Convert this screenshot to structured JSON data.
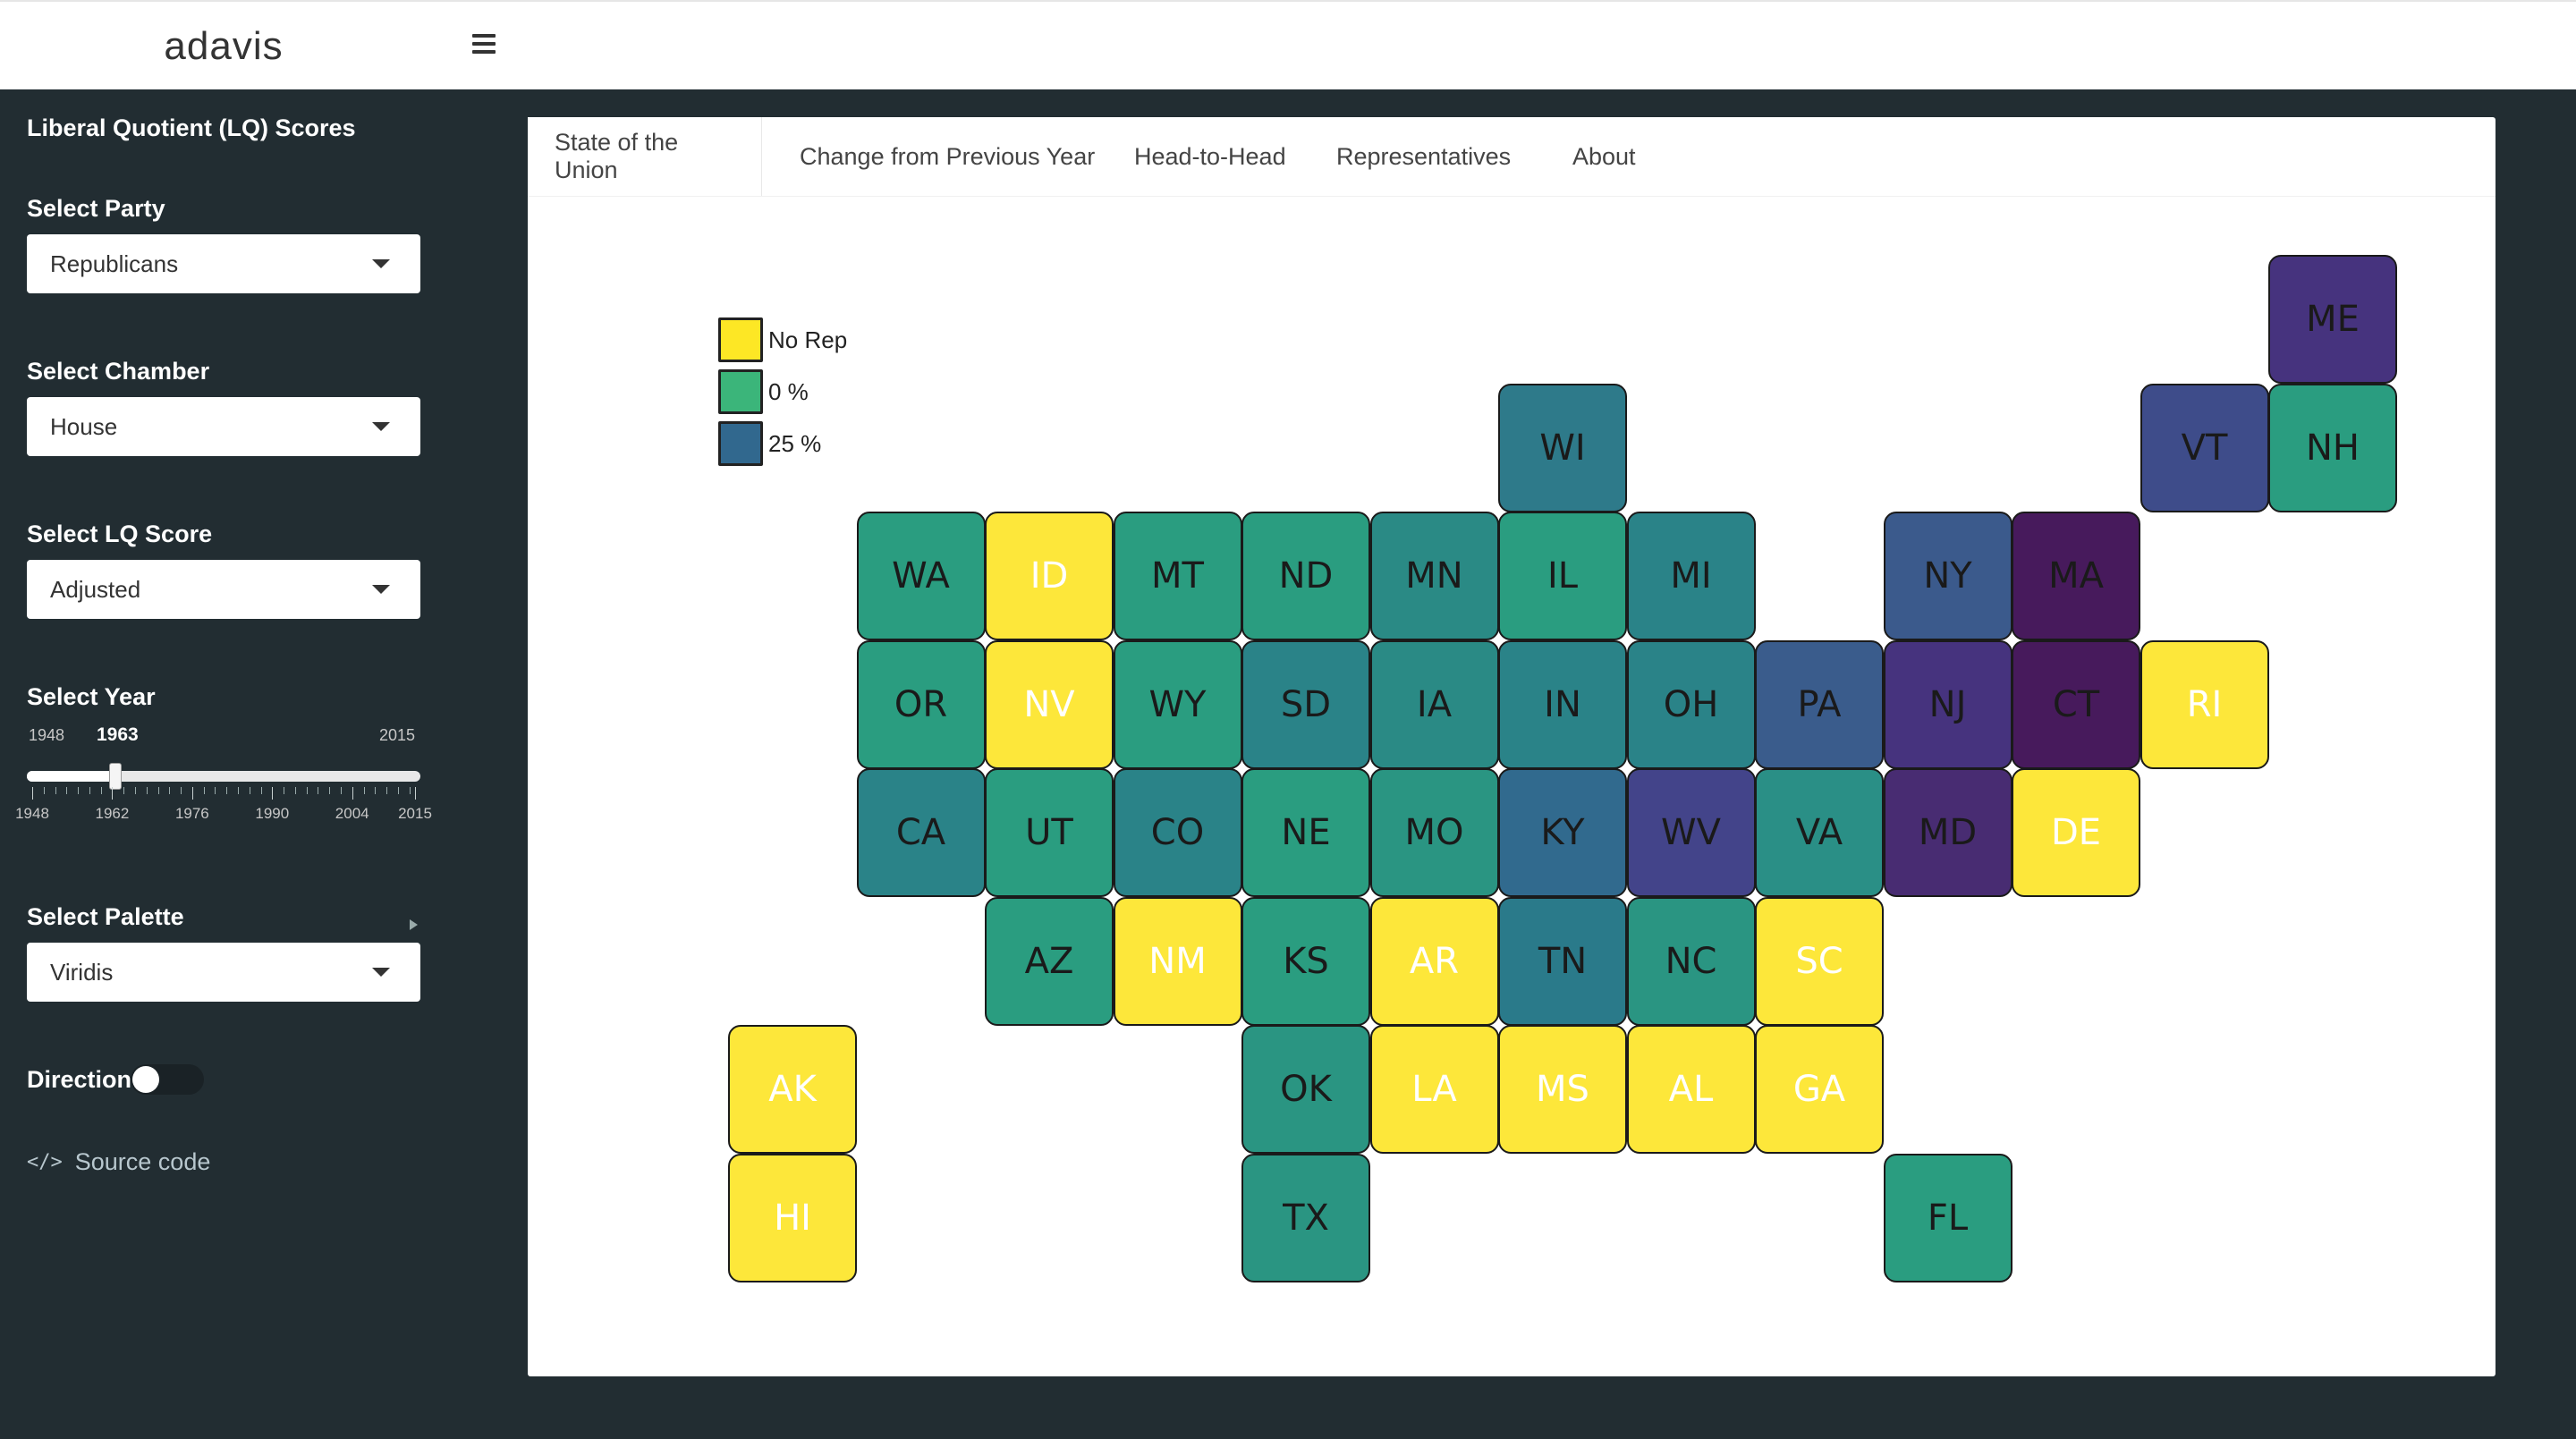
{
  "header": {
    "logo": "adavis"
  },
  "sidebar": {
    "title": "Liberal Quotient (LQ) Scores",
    "party": {
      "label": "Select Party",
      "value": "Republicans"
    },
    "chamber": {
      "label": "Select Chamber",
      "value": "House"
    },
    "score": {
      "label": "Select LQ Score",
      "value": "Adjusted"
    },
    "year": {
      "label": "Select Year",
      "min": "1948",
      "max": "2015",
      "value": "1963",
      "value_fraction": 0.224,
      "tick_labels": [
        "1948",
        "1962",
        "1976",
        "1990",
        "2004",
        "2015"
      ]
    },
    "palette": {
      "label": "Select Palette",
      "value": "Viridis"
    },
    "direction": {
      "label": "Direction",
      "on": false
    },
    "source": {
      "label": "Source code",
      "icon": "code-icon"
    }
  },
  "tabs": [
    {
      "label": "State of the Union",
      "active": true
    },
    {
      "label": "Change from Previous Year",
      "active": false
    },
    {
      "label": "Head-to-Head",
      "active": false
    },
    {
      "label": "Representatives",
      "active": false
    },
    {
      "label": "About",
      "active": false
    }
  ],
  "legend": [
    {
      "label": "No Rep",
      "color": "#fde725"
    },
    {
      "label": "0 %",
      "color": "#3bb57a"
    },
    {
      "label": "25 %",
      "color": "#31688e"
    }
  ],
  "states": [
    {
      "abbr": "ME",
      "color": "#46337e",
      "text": "#1a1a1a"
    },
    {
      "abbr": "WI",
      "color": "#2e7a8a",
      "text": "#1a1a1a"
    },
    {
      "abbr": "VT",
      "color": "#3e4c8a",
      "text": "#1a1a1a"
    },
    {
      "abbr": "NH",
      "color": "#2a9d80",
      "text": "#1a1a1a"
    },
    {
      "abbr": "WA",
      "color": "#2a9d80",
      "text": "#1a1a1a"
    },
    {
      "abbr": "ID",
      "color": "#fde73a",
      "text": "#ffffff"
    },
    {
      "abbr": "MT",
      "color": "#2a9d80",
      "text": "#1a1a1a"
    },
    {
      "abbr": "ND",
      "color": "#2a9d80",
      "text": "#1a1a1a"
    },
    {
      "abbr": "MN",
      "color": "#2a8a85",
      "text": "#1a1a1a"
    },
    {
      "abbr": "IL",
      "color": "#2a9d80",
      "text": "#1a1a1a"
    },
    {
      "abbr": "MI",
      "color": "#2a8388",
      "text": "#1a1a1a"
    },
    {
      "abbr": "NY",
      "color": "#3b5a8c",
      "text": "#1a1a1a"
    },
    {
      "abbr": "MA",
      "color": "#471a5c",
      "text": "#1a1a1a"
    },
    {
      "abbr": "OR",
      "color": "#2a9d80",
      "text": "#1a1a1a"
    },
    {
      "abbr": "NV",
      "color": "#fde73a",
      "text": "#ffffff"
    },
    {
      "abbr": "WY",
      "color": "#2a9d80",
      "text": "#1a1a1a"
    },
    {
      "abbr": "SD",
      "color": "#2a8388",
      "text": "#1a1a1a"
    },
    {
      "abbr": "IA",
      "color": "#2a8a85",
      "text": "#1a1a1a"
    },
    {
      "abbr": "IN",
      "color": "#2a8388",
      "text": "#1a1a1a"
    },
    {
      "abbr": "OH",
      "color": "#2a8388",
      "text": "#1a1a1a"
    },
    {
      "abbr": "PA",
      "color": "#3a5c8c",
      "text": "#1a1a1a"
    },
    {
      "abbr": "NJ",
      "color": "#46337e",
      "text": "#1a1a1a"
    },
    {
      "abbr": "CT",
      "color": "#471a5c",
      "text": "#1a1a1a"
    },
    {
      "abbr": "RI",
      "color": "#fde73a",
      "text": "#ffffff"
    },
    {
      "abbr": "CA",
      "color": "#2a8388",
      "text": "#1a1a1a"
    },
    {
      "abbr": "UT",
      "color": "#2a9d80",
      "text": "#1a1a1a"
    },
    {
      "abbr": "CO",
      "color": "#2a8388",
      "text": "#1a1a1a"
    },
    {
      "abbr": "NE",
      "color": "#2a9d80",
      "text": "#1a1a1a"
    },
    {
      "abbr": "MO",
      "color": "#2a9582",
      "text": "#1a1a1a"
    },
    {
      "abbr": "KY",
      "color": "#316a8e",
      "text": "#1a1a1a"
    },
    {
      "abbr": "WV",
      "color": "#43448a",
      "text": "#1a1a1a"
    },
    {
      "abbr": "VA",
      "color": "#2a8f86",
      "text": "#1a1a1a"
    },
    {
      "abbr": "MD",
      "color": "#482c72",
      "text": "#1a1a1a"
    },
    {
      "abbr": "DE",
      "color": "#fde73a",
      "text": "#ffffff"
    },
    {
      "abbr": "AZ",
      "color": "#2a9d80",
      "text": "#1a1a1a"
    },
    {
      "abbr": "NM",
      "color": "#fde73a",
      "text": "#ffffff"
    },
    {
      "abbr": "KS",
      "color": "#2a9d80",
      "text": "#1a1a1a"
    },
    {
      "abbr": "AR",
      "color": "#fde73a",
      "text": "#ffffff"
    },
    {
      "abbr": "TN",
      "color": "#2a7a8a",
      "text": "#1a1a1a"
    },
    {
      "abbr": "NC",
      "color": "#2a9582",
      "text": "#1a1a1a"
    },
    {
      "abbr": "SC",
      "color": "#fde73a",
      "text": "#ffffff"
    },
    {
      "abbr": "AK",
      "color": "#fde73a",
      "text": "#ffffff"
    },
    {
      "abbr": "OK",
      "color": "#2a9582",
      "text": "#1a1a1a"
    },
    {
      "abbr": "LA",
      "color": "#fde73a",
      "text": "#ffffff"
    },
    {
      "abbr": "MS",
      "color": "#fde73a",
      "text": "#ffffff"
    },
    {
      "abbr": "AL",
      "color": "#fde73a",
      "text": "#ffffff"
    },
    {
      "abbr": "GA",
      "color": "#fde73a",
      "text": "#ffffff"
    },
    {
      "abbr": "HI",
      "color": "#fde73a",
      "text": "#ffffff"
    },
    {
      "abbr": "TX",
      "color": "#2a9582",
      "text": "#1a1a1a"
    },
    {
      "abbr": "FL",
      "color": "#2a9d80",
      "text": "#1a1a1a"
    }
  ]
}
